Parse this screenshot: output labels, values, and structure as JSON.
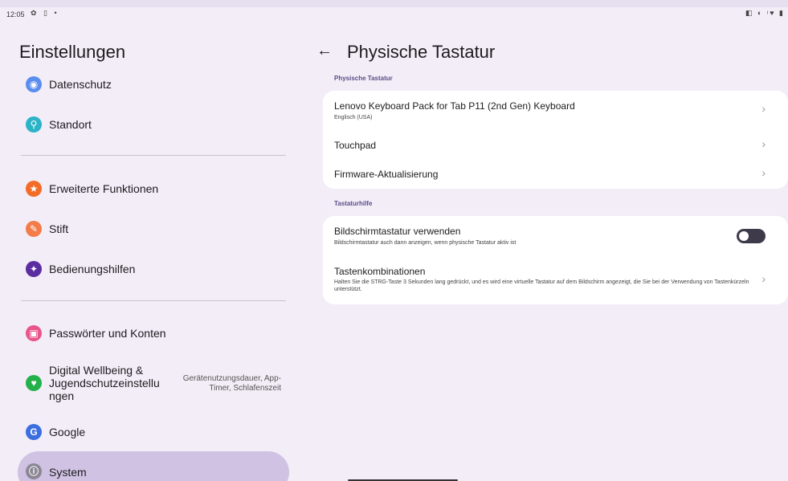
{
  "status_bar": {
    "time": "12:05",
    "left_icons": "✿ ▯ •",
    "right_icons": "◧ ◐ ᵎ♥ ▮"
  },
  "left_pane": {
    "title": "Einstellungen",
    "items": [
      {
        "label": "Datenschutz",
        "icon": "privacy-eye-icon",
        "color": "#5b8def"
      },
      {
        "label": "Standort",
        "icon": "location-pin-icon",
        "color": "#2bb3c7"
      },
      {
        "label": "Erweiterte Funktionen",
        "icon": "star-icon",
        "color": "#f26b27"
      },
      {
        "label": "Stift",
        "icon": "pen-icon",
        "color": "#f47b4a"
      },
      {
        "label": "Bedienungshilfen",
        "icon": "accessibility-icon",
        "color": "#5a2ea0"
      },
      {
        "label": "Passwörter und Konten",
        "icon": "password-icon",
        "color": "#e8558a"
      },
      {
        "label": "Digital Wellbeing & Jugendschutzeinstellu ngen",
        "icon": "wellbeing-icon",
        "color": "#24b04a",
        "summary": "Gerätenutzungsdauer, App-Timer, Schlafenszeit"
      },
      {
        "label": "Google",
        "icon": "google-icon",
        "color": "#3b6fe0"
      },
      {
        "label": "System",
        "icon": "system-info-icon",
        "color": "#8c8794",
        "selected": true
      }
    ]
  },
  "right_pane": {
    "title": "Physische Tastatur",
    "section1_label": "Physische Tastatur",
    "keyboard_title": "Lenovo Keyboard Pack for Tab P11 (2nd Gen) Keyboard",
    "keyboard_sub": "Englisch (USA)",
    "touchpad": "Touchpad",
    "firmware": "Firmware-Aktualisierung",
    "section2_label": "Tastaturhilfe",
    "onscreen_title": "Bildschirmtastatur verwenden",
    "onscreen_sub": "Bildschirmtastatur auch dann anzeigen, wenn physische Tastatur aktiv ist",
    "onscreen_enabled": false,
    "shortcuts_title": "Tastenkombinationen",
    "shortcuts_sub": "Halten Sie die STRG-Taste 3 Sekunden lang gedrückt, und es wird eine virtuelle Tastatur auf dem Bildschirm angezeigt, die Sie bei der Verwendung von Tastenkürzeln unterstützt."
  },
  "icons": {
    "back": "←",
    "chevron": "›"
  },
  "colors": {
    "background": "#f3edf7",
    "selected_item": "#d0c2e2",
    "section_label": "#5b4d8a"
  }
}
